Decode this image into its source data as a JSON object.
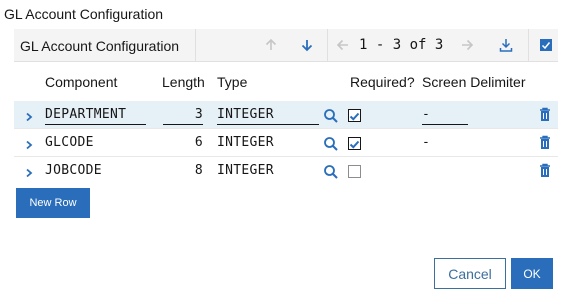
{
  "dialog": {
    "title": "GL Account Configuration"
  },
  "toolbar": {
    "table_title": "GL Account Configuration",
    "pager_text": "1 - 3 of 3"
  },
  "columns": {
    "component": "Component",
    "length": "Length",
    "type": "Type",
    "required": "Required?",
    "screen_delimiter": "Screen Delimiter"
  },
  "rows": [
    {
      "component": "DEPARTMENT",
      "length": "3",
      "type": "INTEGER",
      "required": true,
      "delimiter": "-"
    },
    {
      "component": "GLCODE",
      "length": "6",
      "type": "INTEGER",
      "required": true,
      "delimiter": "-"
    },
    {
      "component": "JOBCODE",
      "length": "8",
      "type": "INTEGER",
      "required": false,
      "delimiter": ""
    }
  ],
  "buttons": {
    "new_row": "New Row",
    "cancel": "Cancel",
    "ok": "OK"
  },
  "colors": {
    "accent": "#2a6ebb",
    "selected_row": "#e5f0f7",
    "toolbar_bg": "#f4f4f4"
  }
}
